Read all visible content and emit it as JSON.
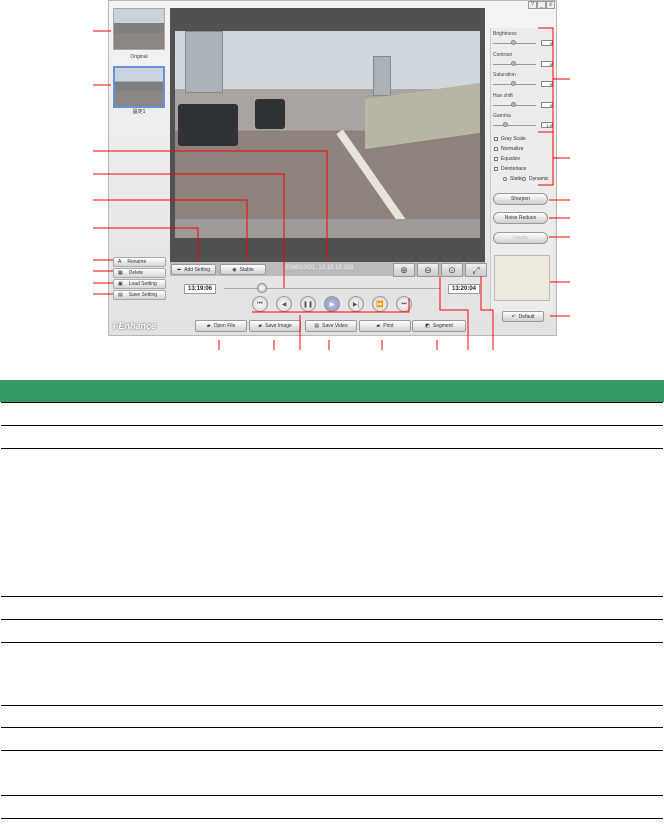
{
  "window": {
    "controls": [
      "?",
      "_",
      "x"
    ]
  },
  "sidebar": {
    "thumb_original": "Original",
    "thumb_setting": "設定1",
    "buttons": [
      {
        "icon": "rename-icon",
        "label": "Rename"
      },
      {
        "icon": "trash-icon",
        "label": "Delete"
      },
      {
        "icon": "load-icon",
        "label": "Load Setting"
      },
      {
        "icon": "save-icon",
        "label": "Save Setting"
      }
    ],
    "logo": "i-Enhance"
  },
  "video": {
    "timestamp": "2006/10/01, 13:19:18.258",
    "add_setting": "Add Setting",
    "stable": "Stable",
    "start_time": "13:19:06",
    "end_time": "13:20:04",
    "seek_fraction": 0.2
  },
  "playback": [
    "skip-start-icon",
    "step-back-icon",
    "pause-icon",
    "play-icon",
    "step-forward-icon",
    "fast-forward-icon",
    "skip-end-icon"
  ],
  "zoom": [
    "zoom-in-icon",
    "zoom-out-icon",
    "zoom-reset-icon",
    "fullscreen-icon"
  ],
  "adjust": {
    "sliders": [
      {
        "label": "Brightness",
        "value": "0"
      },
      {
        "label": "Contrast",
        "value": "0"
      },
      {
        "label": "Saturation",
        "value": "0"
      },
      {
        "label": "Hue shift",
        "value": "0"
      },
      {
        "label": "Gamma",
        "value": "1.0"
      }
    ],
    "checkboxes": [
      "Gray Scale",
      "Normalize",
      "Equalize",
      "Deinterlace"
    ],
    "radios": [
      "Static",
      "Dynamic"
    ],
    "sharpen": "Sharpen",
    "noise_reduce": "Noise Reduce",
    "third": "Levels",
    "default": "Default"
  },
  "bottom": [
    "Open File",
    "Save Image",
    "Save Video",
    "Print",
    "Segment"
  ],
  "colors": {
    "callout": "#ff0000",
    "table_header": "#349a68"
  }
}
